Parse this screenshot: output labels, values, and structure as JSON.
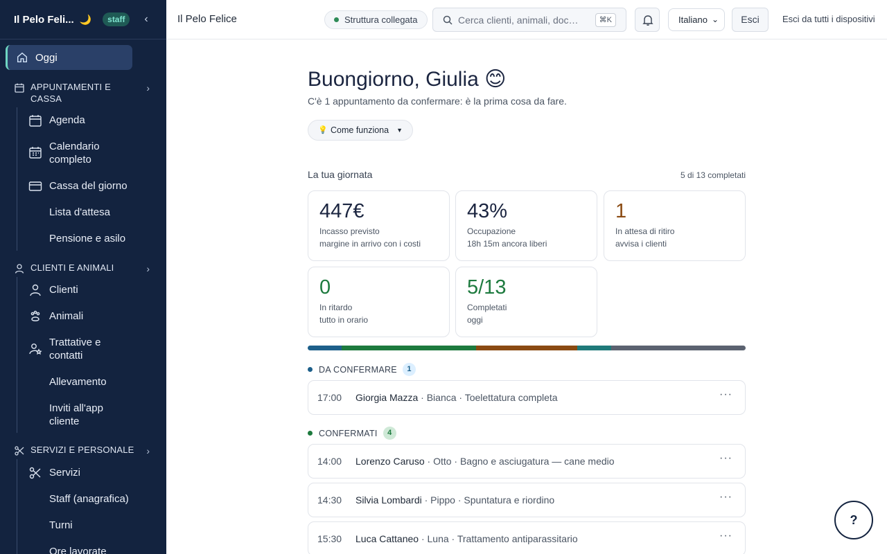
{
  "sidebar": {
    "brand": "Il Pelo Feli...",
    "role_badge": "staff",
    "active_item": "Oggi",
    "sections": [
      {
        "title": "APPUNTAMENTI E CASSA",
        "items": [
          "Agenda",
          "Calendario completo",
          "Cassa del giorno",
          "Lista d'attesa",
          "Pensione e asilo"
        ]
      },
      {
        "title": "CLIENTI E ANIMALI",
        "items": [
          "Clienti",
          "Animali",
          "Trattative e contatti",
          "Allevamento",
          "Inviti all'app cliente"
        ]
      },
      {
        "title": "SERVIZI E PERSONALE",
        "items": [
          "Servizi",
          "Staff (anagrafica)",
          "Turni",
          "Ore lavorate"
        ]
      }
    ]
  },
  "topbar": {
    "title": "Il Pelo Felice",
    "structure_status": "Struttura collegata",
    "search_placeholder": "Cerca clienti, animali, documenti…",
    "search_shortcut": "⌘K",
    "language": "Italiano",
    "logout": "Esci",
    "logout_all": "Esci da tutti i dispositivi"
  },
  "main": {
    "greeting": "Buongiorno, Giulia",
    "greeting_emoji": "😊",
    "subtitle": "C'è 1 appuntamento da confermare: è la prima cosa da fare.",
    "how_it_works": "Come funziona",
    "day_title": "La tua giornata",
    "day_progress": "5 di 13 completati",
    "cards": [
      {
        "value": "447€",
        "label": "Incasso previsto",
        "detail": "margine in arrivo con i costi",
        "color": "#1b2540"
      },
      {
        "value": "43%",
        "label": "Occupazione",
        "detail": "18h 15m ancora liberi",
        "color": "#1b2540"
      },
      {
        "value": "1",
        "label": "In attesa di ritiro",
        "detail": "avvisa i clienti",
        "color": "#8a4a12"
      },
      {
        "value": "0",
        "label": "In ritardo",
        "detail": "tutto in orario",
        "color": "#1d7a3e"
      },
      {
        "value": "5/13",
        "label": "Completati",
        "detail": "oggi",
        "color": "#1d7a3e"
      }
    ],
    "progress_segments": [
      {
        "color": "#1d5f8a",
        "fraction": 0.077
      },
      {
        "color": "#1d7a3e",
        "fraction": 0.308
      },
      {
        "color": "#8a4a12",
        "fraction": 0.231
      },
      {
        "color": "#1f7a7a",
        "fraction": 0.077
      },
      {
        "color": "#5b6270",
        "fraction": 0.307
      }
    ],
    "groups": [
      {
        "label": "DA CONFERMARE",
        "count": "1",
        "color": "#1d5f8a",
        "badge_bg": "#dcefff",
        "badge_fg": "#1d5f8a",
        "appointments": [
          {
            "time": "17:00",
            "client": "Giorgia Mazza",
            "detail": " · Bianca · Toelettatura completa"
          }
        ]
      },
      {
        "label": "CONFERMATI",
        "count": "4",
        "color": "#1d7a3e",
        "badge_bg": "#cfe9d7",
        "badge_fg": "#1d7a3e",
        "appointments": [
          {
            "time": "14:00",
            "client": "Lorenzo Caruso",
            "detail": " · Otto · Bagno e asciugatura — cane medio"
          },
          {
            "time": "14:30",
            "client": "Silvia Lombardi",
            "detail": " · Pippo · Spuntatura e riordino"
          },
          {
            "time": "15:30",
            "client": "Luca Cattaneo",
            "detail": " · Luna · Trattamento antiparassitario"
          }
        ]
      }
    ],
    "more_label": "···"
  },
  "help_label": "?"
}
